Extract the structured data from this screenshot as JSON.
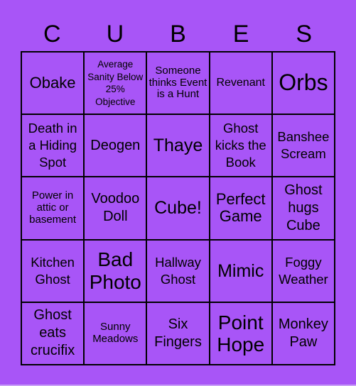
{
  "title_letters": [
    "C",
    "U",
    "B",
    "E",
    "S"
  ],
  "cells": [
    "Obake",
    "Average Sanity Below 25% Objective",
    "Someone thinks Event is a Hunt",
    "Revenant",
    "Orbs",
    "Death in a Hiding Spot",
    "Deogen",
    "Thaye",
    "Ghost kicks the Book",
    "Banshee Scream",
    "Power in attic or basement",
    "Voodoo Doll",
    "Cube!",
    "Perfect Game",
    "Ghost hugs Cube",
    "Kitchen Ghost",
    "Bad Photo",
    "Hallway Ghost",
    "Mimic",
    "Foggy Weather",
    "Ghost eats crucifix",
    "Sunny Meadows",
    "Six Fingers",
    "Point Hope",
    "Monkey Paw"
  ],
  "colors": {
    "background": "#a855f7",
    "grid_lines": "#000000",
    "text": "#000000"
  }
}
